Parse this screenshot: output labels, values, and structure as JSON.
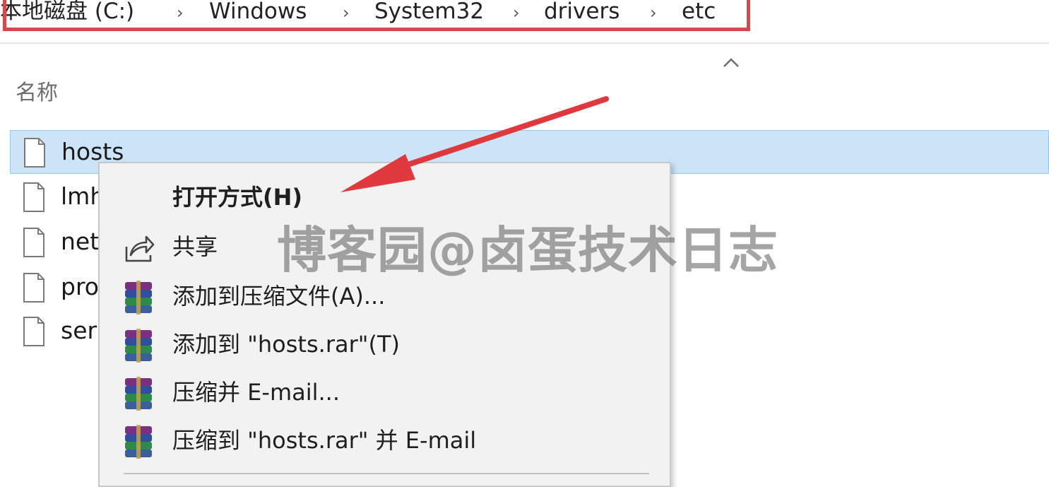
{
  "breadcrumb": {
    "items": [
      "本地磁盘 (C:)",
      "Windows",
      "System32",
      "drivers",
      "etc"
    ],
    "separator": "›"
  },
  "column_header": "名称",
  "files": [
    {
      "name": "hosts",
      "selected": true
    },
    {
      "name": "lmh",
      "selected": false
    },
    {
      "name": "net",
      "selected": false
    },
    {
      "name": "pro",
      "selected": false
    },
    {
      "name": "ser",
      "selected": false
    }
  ],
  "context_menu": {
    "items": [
      {
        "label": "打开方式(H)",
        "icon": "none",
        "bold": true
      },
      {
        "label": "共享",
        "icon": "share-icon"
      },
      {
        "label": "添加到压缩文件(A)...",
        "icon": "winrar-icon"
      },
      {
        "label": "添加到 \"hosts.rar\"(T)",
        "icon": "winrar-icon"
      },
      {
        "label": "压缩并 E-mail...",
        "icon": "winrar-icon"
      },
      {
        "label": "压缩到 \"hosts.rar\" 并 E-mail",
        "icon": "winrar-icon"
      }
    ]
  },
  "watermark": "博客园@卤蛋技术日志",
  "colors": {
    "highlight_box": "#d8474b",
    "selection": "#cce4f7",
    "arrow": "#e0393d",
    "menu_bg": "#f2f2f2"
  }
}
